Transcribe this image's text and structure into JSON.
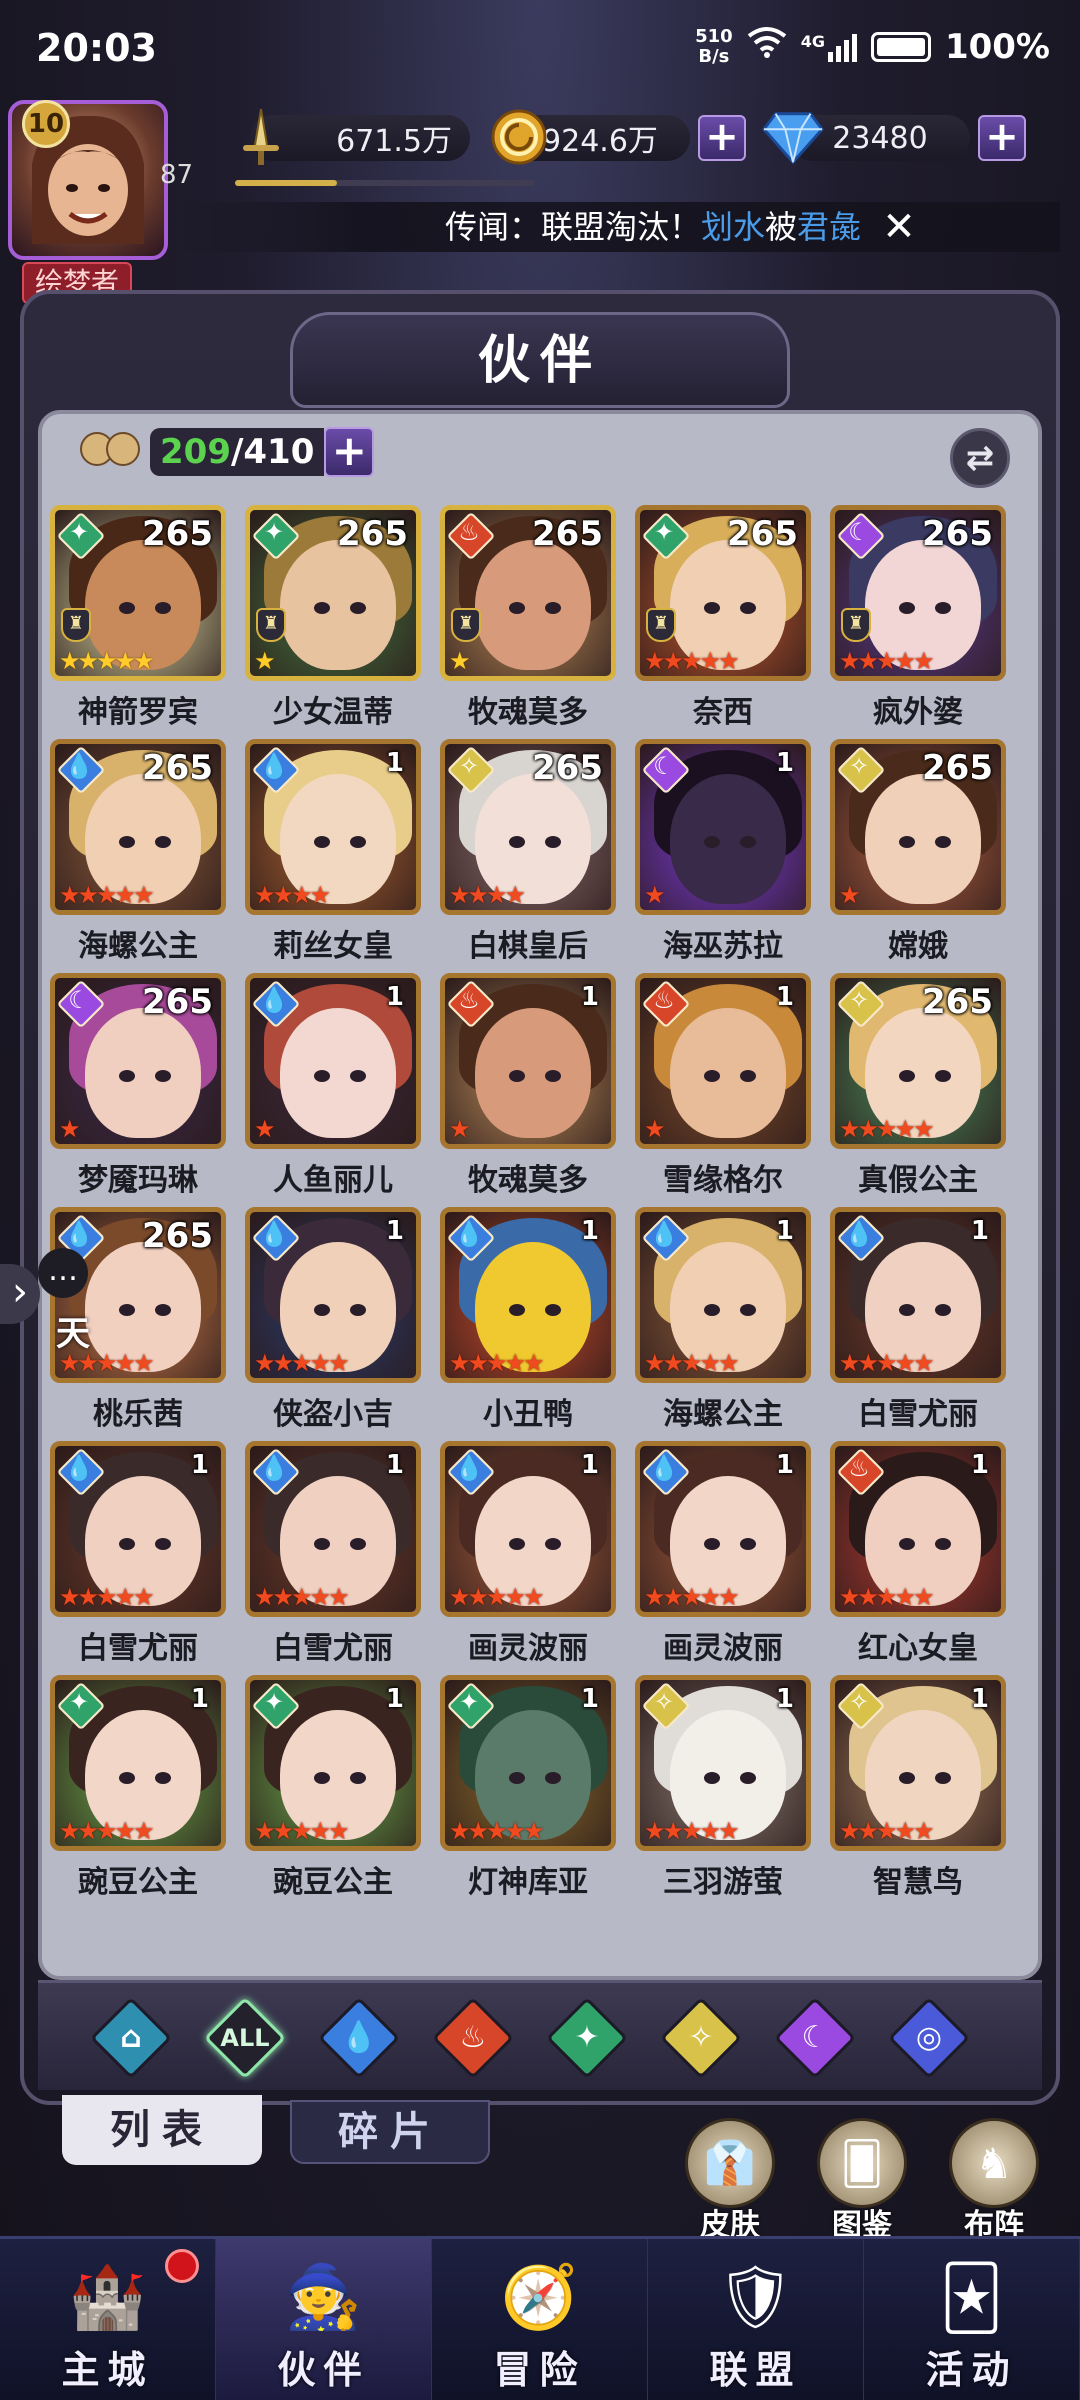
{
  "status": {
    "time": "20:03",
    "net_speed_value": "510",
    "net_speed_unit": "B/s",
    "network": "4G",
    "battery": "100%"
  },
  "player": {
    "level": "10",
    "sub_level": "87",
    "title": "绘梦者",
    "exp_fraction": 0.34
  },
  "resources": {
    "power": "671.5万",
    "gold": "924.6万",
    "gems": "23480"
  },
  "rumor": {
    "prefix": "传闻：联盟淘汰！",
    "actor": "划水",
    "middle": "被",
    "target": "君彘"
  },
  "panel": {
    "title": "伙伴"
  },
  "roster": {
    "owned": "209",
    "capacity": "/410"
  },
  "hero_rows": [
    [
      {
        "name": "神箭罗宾",
        "level": "265",
        "element": "wind",
        "stars": 5,
        "star_color": "gold",
        "frame": "gold",
        "crest": true,
        "palette": [
          "#c88a5a",
          "#4a2818",
          "#d9d6a0"
        ]
      },
      {
        "name": "少女温蒂",
        "level": "265",
        "element": "wind",
        "stars": 1,
        "star_color": "gold",
        "frame": "gold",
        "crest": true,
        "palette": [
          "#e8c3a0",
          "#9c7a3a",
          "#44723e"
        ]
      },
      {
        "name": "牧魂莫多",
        "level": "265",
        "element": "fire",
        "stars": 1,
        "star_color": "gold",
        "frame": "gold",
        "crest": true,
        "palette": [
          "#d79a7a",
          "#4a2a1a",
          "#b88a58"
        ]
      },
      {
        "name": "奈西",
        "level": "265",
        "element": "wind",
        "stars": 5,
        "star_color": "red",
        "frame": "bronze",
        "crest": true,
        "palette": [
          "#f0cfb2",
          "#d8ae5a",
          "#c0582e"
        ]
      },
      {
        "name": "疯外婆",
        "level": "265",
        "element": "dark",
        "stars": 5,
        "star_color": "red",
        "frame": "bronze",
        "crest": true,
        "palette": [
          "#f2d6d6",
          "#3a3a62",
          "#5a3a8a"
        ]
      }
    ],
    [
      {
        "name": "海螺公主",
        "level": "265",
        "element": "water",
        "stars": 5,
        "star_color": "red",
        "frame": "bronze",
        "crest": false,
        "palette": [
          "#f0cfb2",
          "#d8b26a",
          "#8a5a3a"
        ]
      },
      {
        "name": "莉丝女皇",
        "level": "1",
        "element": "water",
        "stars": 4,
        "star_color": "red",
        "frame": "bronze",
        "crest": false,
        "palette": [
          "#f2d8c0",
          "#e8cc8a",
          "#a86030"
        ]
      },
      {
        "name": "白棋皇后",
        "level": "265",
        "element": "light",
        "stars": 4,
        "star_color": "red",
        "frame": "bronze",
        "crest": false,
        "palette": [
          "#f2e0d8",
          "#d8d4d0",
          "#8a6a6a"
        ]
      },
      {
        "name": "海巫苏拉",
        "level": "1",
        "element": "dark",
        "stars": 1,
        "star_color": "red",
        "frame": "bronze",
        "crest": false,
        "palette": [
          "#3a2a4a",
          "#1a1020",
          "#7a3ad8"
        ]
      },
      {
        "name": "嫦娥",
        "level": "265",
        "element": "light",
        "stars": 1,
        "star_color": "red",
        "frame": "bronze",
        "crest": false,
        "palette": [
          "#f0d0b8",
          "#4a2a1a",
          "#b06040"
        ]
      }
    ],
    [
      {
        "name": "梦魇玛琳",
        "level": "265",
        "element": "dark",
        "stars": 1,
        "star_color": "red",
        "frame": "bronze",
        "crest": false,
        "palette": [
          "#f0cfc0",
          "#a84a9a",
          "#3a2848"
        ]
      },
      {
        "name": "人鱼丽儿",
        "level": "1",
        "element": "water",
        "stars": 1,
        "star_color": "red",
        "frame": "bronze",
        "crest": false,
        "palette": [
          "#f2d8d0",
          "#b04a3a",
          "#3a2838"
        ]
      },
      {
        "name": "牧魂莫多",
        "level": "1",
        "element": "fire",
        "stars": 1,
        "star_color": "red",
        "frame": "bronze",
        "crest": false,
        "palette": [
          "#d79a7a",
          "#4a2a1a",
          "#b88a58"
        ]
      },
      {
        "name": "雪缘格尔",
        "level": "1",
        "element": "fire",
        "stars": 1,
        "star_color": "red",
        "frame": "bronze",
        "crest": false,
        "palette": [
          "#e8bc98",
          "#c88a3a",
          "#7a4a2a"
        ]
      },
      {
        "name": "真假公主",
        "level": "265",
        "element": "light",
        "stars": 5,
        "star_color": "red",
        "frame": "bronze",
        "crest": false,
        "palette": [
          "#f2d6c0",
          "#e0b870",
          "#4a8a5a"
        ]
      }
    ],
    [
      {
        "name": "桃乐茜",
        "level": "265",
        "element": "water",
        "stars": 5,
        "star_color": "red",
        "frame": "bronze",
        "crest": false,
        "palette": [
          "#f2d0c0",
          "#7a4a2a",
          "#c87a4a"
        ]
      },
      {
        "name": "侠盗小吉",
        "level": "1",
        "element": "water",
        "stars": 5,
        "star_color": "red",
        "frame": "bronze",
        "crest": false,
        "palette": [
          "#f0d0b8",
          "#3a2a3a",
          "#2a3a6a"
        ]
      },
      {
        "name": "小丑鸭",
        "level": "1",
        "element": "water",
        "stars": 5,
        "star_color": "red",
        "frame": "bronze",
        "crest": false,
        "palette": [
          "#f0c830",
          "#3a6aa8",
          "#c84a2a"
        ]
      },
      {
        "name": "海螺公主",
        "level": "1",
        "element": "water",
        "stars": 5,
        "star_color": "red",
        "frame": "bronze",
        "crest": false,
        "palette": [
          "#f0cfb2",
          "#d8b26a",
          "#8a5a3a"
        ]
      },
      {
        "name": "白雪尤丽",
        "level": "1",
        "element": "water",
        "stars": 5,
        "star_color": "red",
        "frame": "bronze",
        "crest": false,
        "palette": [
          "#f0d0c0",
          "#3a2a2a",
          "#6a3a2a"
        ]
      }
    ],
    [
      {
        "name": "白雪尤丽",
        "level": "1",
        "element": "water",
        "stars": 5,
        "star_color": "red",
        "frame": "bronze",
        "crest": false,
        "palette": [
          "#f0d0c0",
          "#3a2a2a",
          "#6a3a2a"
        ]
      },
      {
        "name": "白雪尤丽",
        "level": "1",
        "element": "water",
        "stars": 5,
        "star_color": "red",
        "frame": "bronze",
        "crest": false,
        "palette": [
          "#f0d0c0",
          "#3a2a2a",
          "#6a3a2a"
        ]
      },
      {
        "name": "画灵波丽",
        "level": "1",
        "element": "water",
        "stars": 5,
        "star_color": "red",
        "frame": "bronze",
        "crest": false,
        "palette": [
          "#f2d6c8",
          "#4a2a22",
          "#a05a3a"
        ]
      },
      {
        "name": "画灵波丽",
        "level": "1",
        "element": "water",
        "stars": 5,
        "star_color": "red",
        "frame": "bronze",
        "crest": false,
        "palette": [
          "#f2d6c8",
          "#4a2a22",
          "#a05a3a"
        ]
      },
      {
        "name": "红心女皇",
        "level": "1",
        "element": "fire",
        "stars": 5,
        "star_color": "red",
        "frame": "bronze",
        "crest": false,
        "palette": [
          "#f0cfc0",
          "#2a1a1a",
          "#b03a30"
        ]
      }
    ],
    [
      {
        "name": "豌豆公主",
        "level": "1",
        "element": "wind",
        "stars": 5,
        "star_color": "red",
        "frame": "bronze",
        "crest": false,
        "palette": [
          "#f2d6c8",
          "#3a2420",
          "#6aa84a"
        ]
      },
      {
        "name": "豌豆公主",
        "level": "1",
        "element": "wind",
        "stars": 5,
        "star_color": "red",
        "frame": "bronze",
        "crest": false,
        "palette": [
          "#f2d6c8",
          "#3a2420",
          "#6aa84a"
        ]
      },
      {
        "name": "灯神库亚",
        "level": "1",
        "element": "wind",
        "stars": 5,
        "star_color": "red",
        "frame": "bronze",
        "crest": false,
        "palette": [
          "#5a7a6a",
          "#2a4a3a",
          "#8a6a2a"
        ]
      },
      {
        "name": "三羽游萤",
        "level": "1",
        "element": "light",
        "stars": 5,
        "star_color": "red",
        "frame": "bronze",
        "crest": false,
        "palette": [
          "#f2eee8",
          "#e0dcd8",
          "#8a7a70"
        ]
      },
      {
        "name": "智慧鸟",
        "level": "1",
        "element": "light",
        "stars": 5,
        "star_color": "red",
        "frame": "bronze",
        "crest": false,
        "palette": [
          "#f0d6c0",
          "#e0c490",
          "#a07a5a"
        ]
      }
    ]
  ],
  "element_colors": {
    "wind": "#2fa36a",
    "fire": "#d8462a",
    "water": "#3a7ee0",
    "dark": "#9a4ae0",
    "light": "#d8c24a",
    "all": "#23222c",
    "base": "#2f8fb0",
    "cosmic": "#4a5ad8"
  },
  "element_glyphs": {
    "wind": "✦",
    "fire": "♨",
    "water": "💧",
    "dark": "☾",
    "light": "✧",
    "base": "⌂",
    "cosmic": "◎"
  },
  "filters": [
    {
      "id": "base",
      "label": ""
    },
    {
      "id": "all",
      "label": "ALL"
    },
    {
      "id": "water",
      "label": ""
    },
    {
      "id": "fire",
      "label": ""
    },
    {
      "id": "wind",
      "label": ""
    },
    {
      "id": "light",
      "label": ""
    },
    {
      "id": "dark",
      "label": ""
    },
    {
      "id": "cosmic",
      "label": ""
    }
  ],
  "subtabs": {
    "list": "列表",
    "shards": "碎片"
  },
  "quick_actions": {
    "skins": "皮肤",
    "codex": "图鉴",
    "formation": "布阵"
  },
  "nav": {
    "city": "主城",
    "partners": "伙伴",
    "adventure": "冒险",
    "alliance": "联盟",
    "events": "活动"
  },
  "chat_handle": {
    "text": "天"
  }
}
